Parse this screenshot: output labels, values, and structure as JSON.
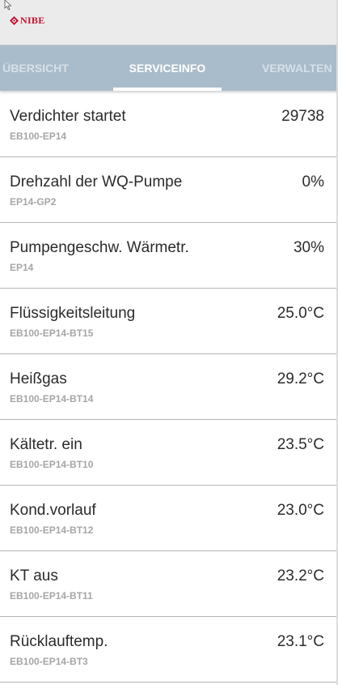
{
  "header": {
    "brand": "NIBE",
    "brand_color": "#c8102e",
    "logo_icon": "nibe-diamond-icon"
  },
  "tabs": [
    {
      "label": "ÜBERSICHT",
      "active": false
    },
    {
      "label": "SERVICEINFO",
      "active": true
    },
    {
      "label": "VERWALTEN",
      "active": false
    }
  ],
  "rows": [
    {
      "label": "Verdichter startet",
      "sub": "EB100-EP14",
      "value": "29738"
    },
    {
      "label": "Drehzahl der WQ-Pumpe",
      "sub": "EP14-GP2",
      "value": "0%"
    },
    {
      "label": "Pumpengeschw. Wärmetr.",
      "sub": "EP14",
      "value": "30%"
    },
    {
      "label": "Flüssigkeitsleitung",
      "sub": "EB100-EP14-BT15",
      "value": "25.0°C"
    },
    {
      "label": "Heißgas",
      "sub": "EB100-EP14-BT14",
      "value": "29.2°C"
    },
    {
      "label": "Kältetr. ein",
      "sub": "EB100-EP14-BT10",
      "value": "23.5°C"
    },
    {
      "label": "Kond.vorlauf",
      "sub": "EB100-EP14-BT12",
      "value": "23.0°C"
    },
    {
      "label": "KT aus",
      "sub": "EB100-EP14-BT11",
      "value": "23.2°C"
    },
    {
      "label": "Rücklauftemp.",
      "sub": "EB100-EP14-BT3",
      "value": "23.1°C"
    }
  ],
  "colors": {
    "tab_bar": "#a9bccb",
    "header_bg": "#ebebeb",
    "sub_text": "#a6a6a6"
  }
}
